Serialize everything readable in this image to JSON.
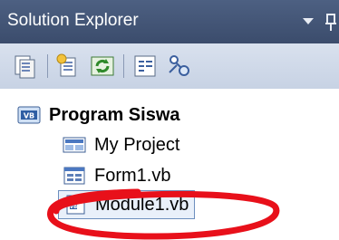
{
  "window": {
    "title": "Solution Explorer"
  },
  "icons": {
    "dropdown": "dropdown-arrow-icon",
    "pin": "pin-icon",
    "toolbar": [
      "show-all-files-icon",
      "properties-icon",
      "refresh-icon",
      "view-code-icon",
      "view-designer-icon"
    ]
  },
  "tree": {
    "project": {
      "label": "Program Siswa",
      "icon": "vb-project-icon"
    },
    "children": [
      {
        "label": "My Project",
        "icon": "my-project-icon"
      },
      {
        "label": "Form1.vb",
        "icon": "form-icon"
      },
      {
        "label": "Module1.vb",
        "icon": "module-icon",
        "selected": true
      }
    ]
  },
  "colors": {
    "title_bar": "#44587a",
    "toolbar": "#d0d9e9",
    "highlight_circle": "#e8101a",
    "selection": "#e9f0fa"
  }
}
